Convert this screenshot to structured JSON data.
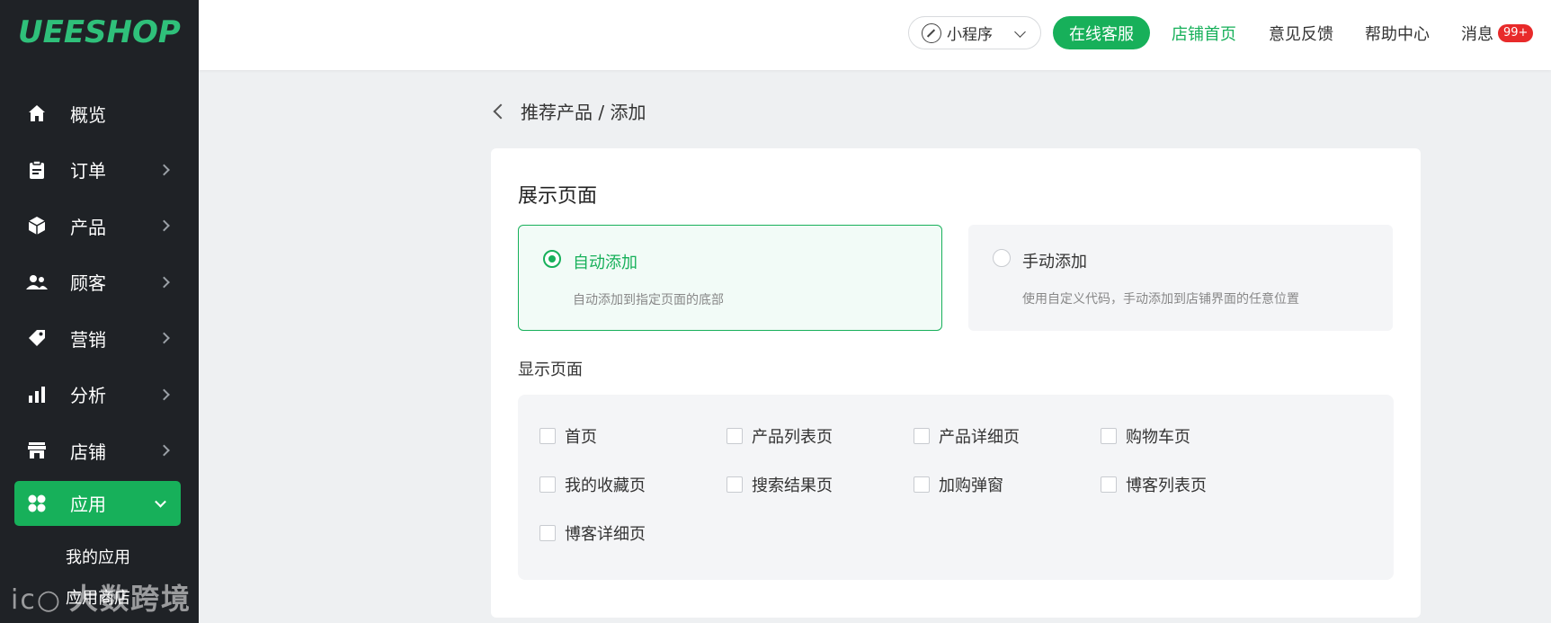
{
  "sidebar": {
    "logo": "UEESHOP",
    "items": [
      {
        "label": "概览",
        "icon": "home-icon"
      },
      {
        "label": "订单",
        "icon": "clipboard-icon"
      },
      {
        "label": "产品",
        "icon": "box-icon"
      },
      {
        "label": "顾客",
        "icon": "users-icon"
      },
      {
        "label": "营销",
        "icon": "tag-icon"
      },
      {
        "label": "分析",
        "icon": "bar-chart-icon"
      },
      {
        "label": "店铺",
        "icon": "store-icon"
      },
      {
        "label": "应用",
        "icon": "apps-grid-icon"
      }
    ],
    "sub_items": [
      "我的应用",
      "应用商店"
    ],
    "watermark": "大数跨境"
  },
  "header": {
    "miniprogram_label": "小程序",
    "online_service": "在线客服",
    "store_home": "店铺首页",
    "feedback": "意见反馈",
    "help_center": "帮助中心",
    "messages": "消息",
    "messages_badge": "99+"
  },
  "breadcrumb": "推荐产品 / 添加",
  "card": {
    "title": "展示页面",
    "options": [
      {
        "label": "自动添加",
        "desc": "自动添加到指定页面的底部",
        "selected": true
      },
      {
        "label": "手动添加",
        "desc": "使用自定义代码，手动添加到店铺界面的任意位置",
        "selected": false
      }
    ],
    "pages_label": "显示页面",
    "pages": [
      "首页",
      "产品列表页",
      "产品详细页",
      "购物车页",
      "我的收藏页",
      "搜索结果页",
      "加购弹窗",
      "博客列表页",
      "博客详细页"
    ]
  },
  "colors": {
    "accent": "#17b05a",
    "sidebar_bg": "#1f2226",
    "badge": "#e82a2a"
  }
}
